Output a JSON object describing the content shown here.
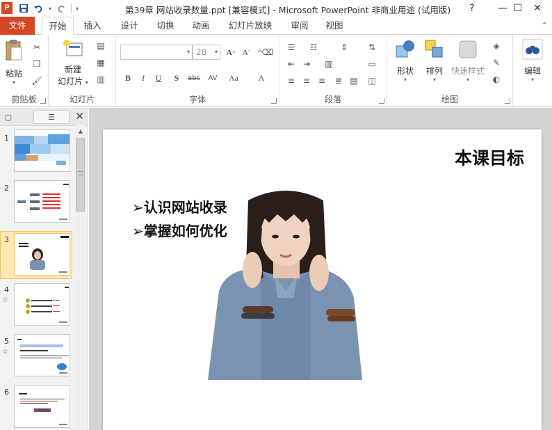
{
  "titlebar": {
    "app_icon": "P",
    "title": "第39章 网站收录数量.ppt [兼容模式] - Microsoft PowerPoint 非商业用途 (试用版)",
    "help": "?",
    "minimize": "—",
    "maximize": "☐",
    "close": "✕"
  },
  "tabs": [
    {
      "label": "文件"
    },
    {
      "label": "开始"
    },
    {
      "label": "插入"
    },
    {
      "label": "设计"
    },
    {
      "label": "切换"
    },
    {
      "label": "动画"
    },
    {
      "label": "幻灯片放映"
    },
    {
      "label": "审阅"
    },
    {
      "label": "视图"
    }
  ],
  "ribbon": {
    "clipboard": {
      "label": "剪贴板",
      "paste": "粘贴"
    },
    "slides": {
      "label": "幻灯片",
      "new_slide_1": "新建",
      "new_slide_2": "幻灯片"
    },
    "font": {
      "label": "字体",
      "size": "28"
    },
    "paragraph": {
      "label": "段落"
    },
    "drawing": {
      "label": "绘图",
      "shapes": "形状",
      "arrange": "排列",
      "quick_styles": "快速样式"
    },
    "editing": {
      "label": "编辑"
    }
  },
  "panel": {
    "slides": [
      {
        "num": "1",
        "starred": false
      },
      {
        "num": "2",
        "starred": false
      },
      {
        "num": "3",
        "starred": false,
        "selected": true
      },
      {
        "num": "4",
        "starred": true
      },
      {
        "num": "5",
        "starred": true
      },
      {
        "num": "6",
        "starred": false
      }
    ],
    "star_glyph": "☆"
  },
  "slide": {
    "title": "本课目标",
    "bullet_marker": "➢",
    "bullets": [
      "认识网站收录",
      "掌握如何优化"
    ]
  },
  "colors": {
    "file_tab": "#d24726",
    "selected_thumb": "#f2c462"
  }
}
